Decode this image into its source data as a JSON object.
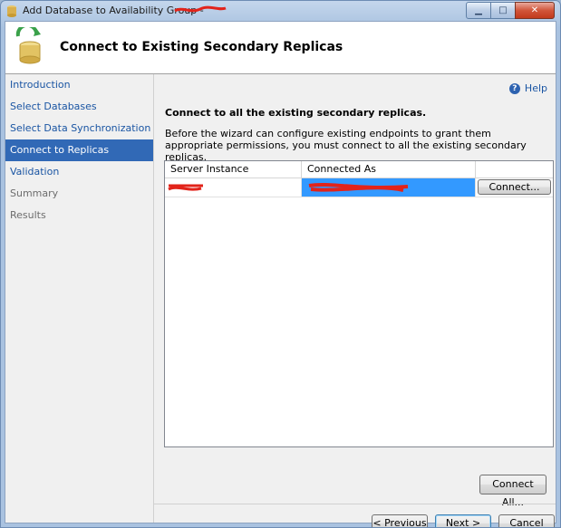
{
  "window": {
    "title": "Add Database to Availability Group - ",
    "minimize_glyph": "▁",
    "maximize_glyph": "□",
    "close_glyph": "✕"
  },
  "header": {
    "title": "Connect to Existing Secondary Replicas",
    "icon": "database-wizard-icon"
  },
  "nav": {
    "items": [
      {
        "label": "Introduction",
        "state": "link"
      },
      {
        "label": "Select Databases",
        "state": "link"
      },
      {
        "label": "Select Data Synchronization",
        "state": "link"
      },
      {
        "label": "Connect to Replicas",
        "state": "selected"
      },
      {
        "label": "Validation",
        "state": "link"
      },
      {
        "label": "Summary",
        "state": "disabled"
      },
      {
        "label": "Results",
        "state": "disabled"
      }
    ]
  },
  "content": {
    "help_label": "Help",
    "heading": "Connect to all the existing secondary replicas.",
    "description": "Before the wizard can configure existing endpoints to grant them appropriate permissions, you must connect to all the existing secondary replicas.",
    "grid": {
      "columns": [
        "Server Instance",
        "Connected As",
        ""
      ],
      "rows": [
        {
          "connect_label": "Connect..."
        }
      ]
    },
    "connect_all_label": "Connect All..."
  },
  "footer": {
    "previous_label": "< Previous",
    "next_label": "Next >",
    "cancel_label": "Cancel"
  },
  "colors": {
    "selected_nav": "#3169b6",
    "link": "#1a55a3",
    "grid_selection": "#3399ff",
    "redaction": "#e2231a"
  }
}
